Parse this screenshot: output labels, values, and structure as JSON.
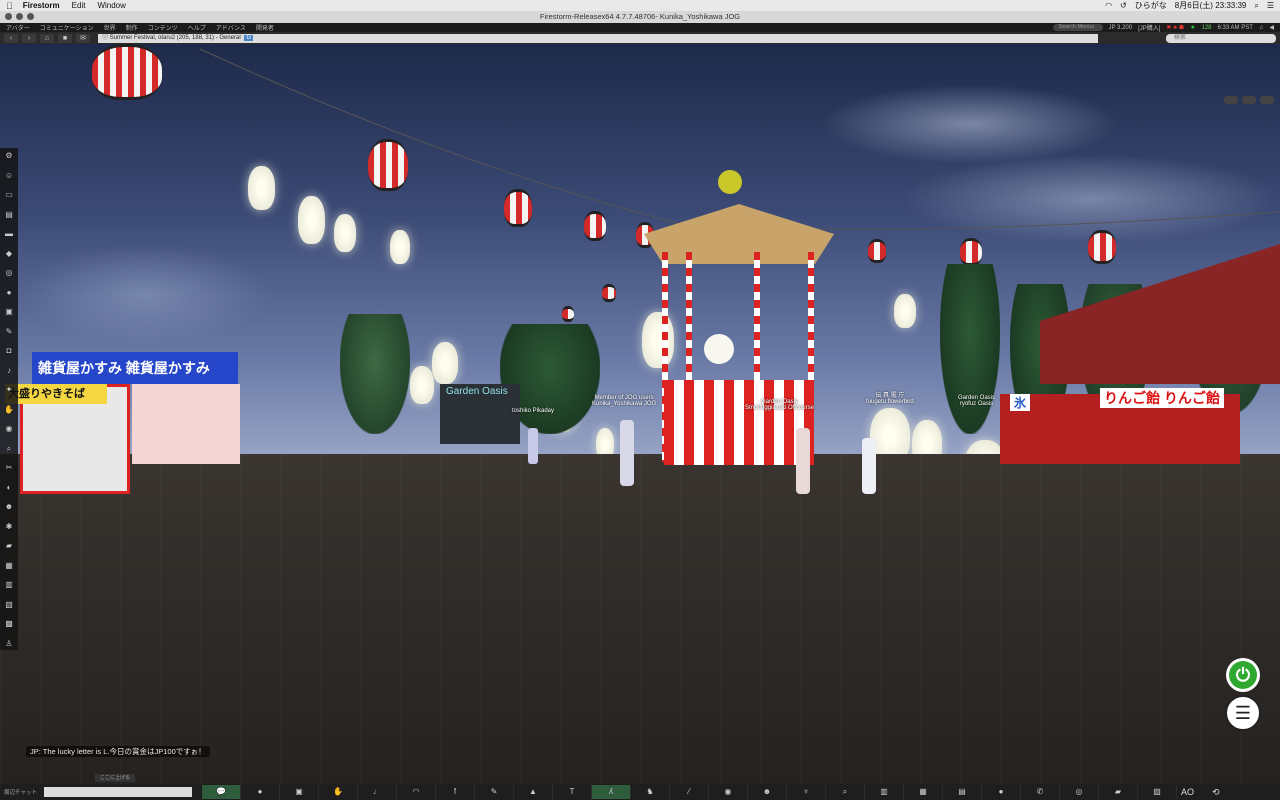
{
  "macos": {
    "app_name": "Firestorm",
    "menus": [
      "Edit",
      "Window"
    ],
    "input_method": "ひらがな",
    "clock": "8月6日(土) 23:33:39"
  },
  "window": {
    "title": "Firestorm-Releasex64 4.7.7.48706- Kunika_Yoshikawa JOG"
  },
  "viewer_menu": {
    "items": [
      "アバター",
      "コミュニケーション",
      "世界",
      "制作",
      "コンテンツ",
      "ヘルプ",
      "アドバンス",
      "開発者"
    ],
    "search_placeholder": "Search Menus",
    "balance": "JP 3,200",
    "balance_button": "[JP購入]",
    "fps": "128",
    "time": "6:33 AM PST"
  },
  "navigation": {
    "location": "Summer Festival, otaru2 (205, 188, 31) - General",
    "rating_badge": "G",
    "search_placeholder": "検索"
  },
  "scene": {
    "avatar_labels": [
      {
        "group": "",
        "name": "toshiko Pikaday"
      },
      {
        "group": "Member of JOG users",
        "name": "Kunika_Yoshikawa JOG"
      },
      {
        "group": "Garden Oasis",
        "name": "Smorfuggiasaki Offcourse"
      },
      {
        "group": "伝 具 電 庁",
        "name": "fuugetu flowerbird"
      },
      {
        "group": "Garden Oasis",
        "name": "ryofuz Oasis"
      }
    ],
    "signs": {
      "shop_banner": "雑貨屋かすみ 雑貨屋かすみ",
      "yakisoba": "大盛りやきそば",
      "garden_oasis": "Garden Oasis",
      "ringo": "りんご飴 りんご飴",
      "ice": "氷"
    }
  },
  "chat": {
    "message": "JP: The lucky letter is L.今日の賞金はJP100ですぉ！",
    "history_tab": "ここに上げる"
  },
  "bottom_bar": {
    "nearby_chat_label": "周辺チャット",
    "ao_label": "AO"
  }
}
